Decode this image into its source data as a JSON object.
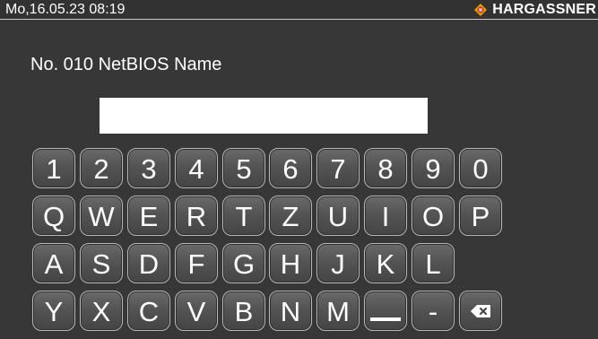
{
  "status": {
    "datetime": "Mo,16.05.23 08:19",
    "brand": "HARGASSNER"
  },
  "title": "No. 010 NetBIOS Name",
  "input": {
    "value": ""
  },
  "keyboard": {
    "row1": [
      "1",
      "2",
      "3",
      "4",
      "5",
      "6",
      "7",
      "8",
      "9",
      "0"
    ],
    "row2": [
      "Q",
      "W",
      "E",
      "R",
      "T",
      "Z",
      "U",
      "I",
      "O",
      "P"
    ],
    "row3": [
      "A",
      "S",
      "D",
      "F",
      "G",
      "H",
      "J",
      "K",
      "L"
    ],
    "row4": [
      "Y",
      "X",
      "C",
      "V",
      "B",
      "N",
      "M"
    ],
    "dash": "-"
  },
  "icons": {
    "brand": "hargassner-logo-icon",
    "backspace": "backspace-icon",
    "space": "space-bar-icon"
  },
  "colors": {
    "background": "#373737",
    "brand_logo": "#f29a00"
  }
}
